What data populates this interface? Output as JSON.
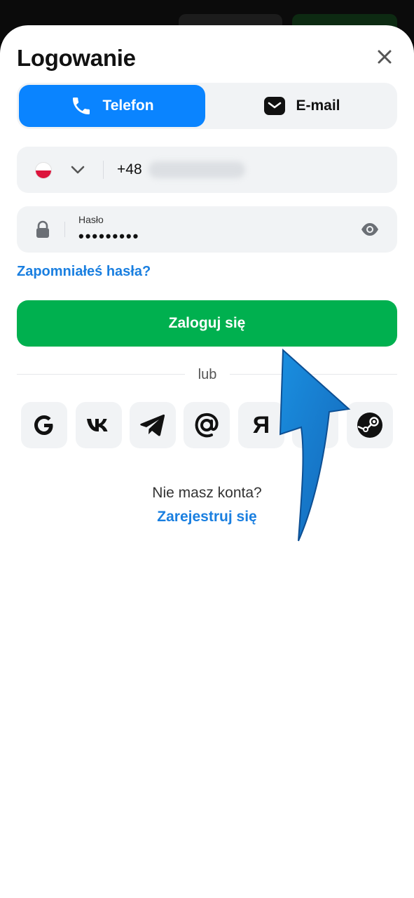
{
  "dialog": {
    "title": "Logowanie"
  },
  "tabs": [
    {
      "label": "Telefon",
      "icon": "phone-icon",
      "active": true
    },
    {
      "label": "E-mail",
      "icon": "mail-icon",
      "active": false
    }
  ],
  "phone_field": {
    "country": "PL",
    "prefix": "+48"
  },
  "password_field": {
    "label": "Hasło",
    "value": "•••••••••"
  },
  "forgot_link": "Zapomniałeś hasła?",
  "login_button": "Zaloguj się",
  "divider_text": "lub",
  "social": [
    {
      "icon": "google-icon"
    },
    {
      "icon": "vk-icon"
    },
    {
      "icon": "telegram-icon"
    },
    {
      "icon": "mail-ru-icon"
    },
    {
      "icon": "yandex-icon",
      "glyph": "Я"
    },
    {
      "icon": "hidden-icon"
    },
    {
      "icon": "steam-icon"
    }
  ],
  "footer": {
    "question": "Nie masz konta?",
    "register_link": "Zarejestruj się"
  },
  "colors": {
    "primary_blue": "#0a84ff",
    "link_blue": "#1a7fe0",
    "login_green": "#00b04f",
    "field_bg": "#f1f3f5"
  }
}
